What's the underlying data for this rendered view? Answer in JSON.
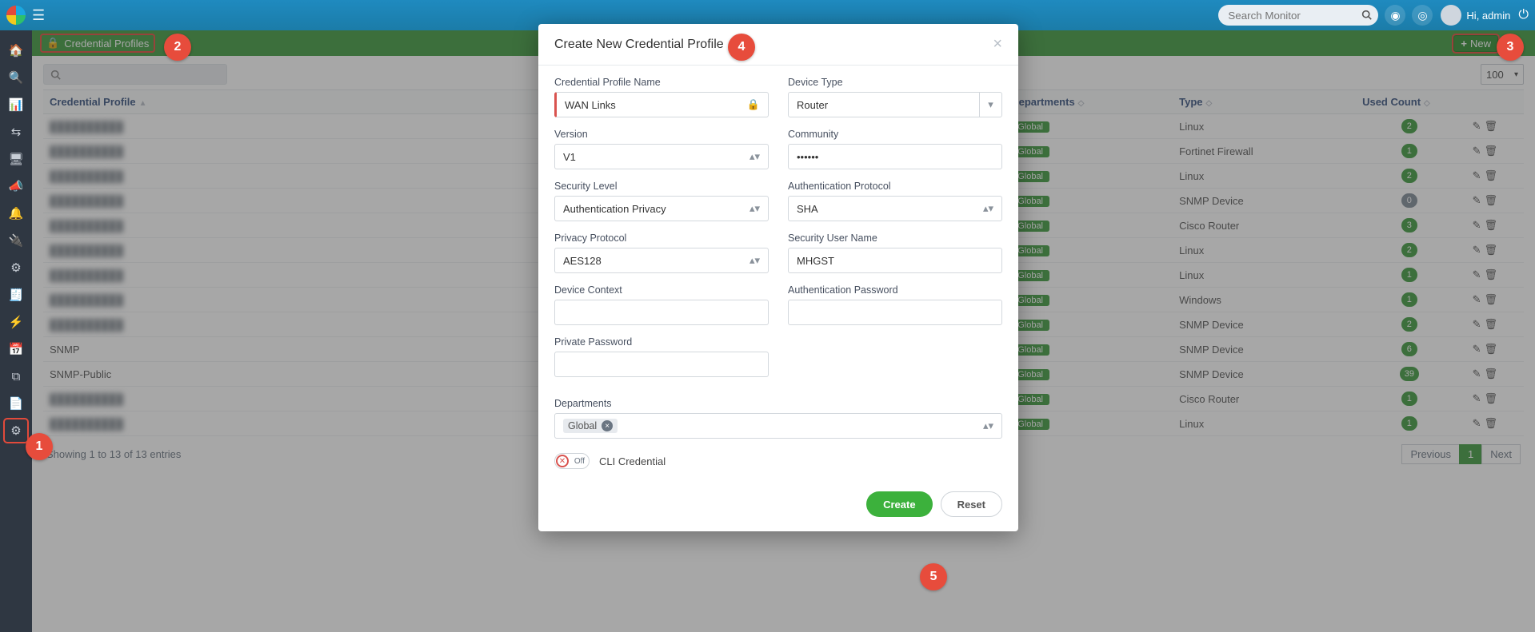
{
  "topbar": {
    "search_placeholder": "Search Monitor",
    "greeting": "Hi, admin"
  },
  "greenbar": {
    "title": "Credential Profiles",
    "new_label": "New"
  },
  "table": {
    "page_size": "100",
    "headers": {
      "name": "Credential Profile",
      "departments": "Departments",
      "type": "Type",
      "used": "Used Count"
    },
    "rows": [
      {
        "name": "—",
        "blur": true,
        "dept": "Global",
        "type": "Linux",
        "count": 2
      },
      {
        "name": "—",
        "blur": true,
        "dept": "Global",
        "type": "Fortinet Firewall",
        "count": 1
      },
      {
        "name": "—",
        "blur": true,
        "dept": "Global",
        "type": "Linux",
        "count": 2
      },
      {
        "name": "—",
        "blur": true,
        "dept": "Global",
        "type": "SNMP Device",
        "count": 0
      },
      {
        "name": "—",
        "blur": true,
        "dept": "Global",
        "type": "Cisco Router",
        "count": 3
      },
      {
        "name": "—",
        "blur": true,
        "dept": "Global",
        "type": "Linux",
        "count": 2
      },
      {
        "name": "—",
        "blur": true,
        "dept": "Global",
        "type": "Linux",
        "count": 1
      },
      {
        "name": "—",
        "blur": true,
        "dept": "Global",
        "type": "Windows",
        "count": 1
      },
      {
        "name": "—",
        "blur": true,
        "dept": "Global",
        "type": "SNMP Device",
        "count": 2
      },
      {
        "name": "SNMP",
        "blur": false,
        "dept": "Global",
        "type": "SNMP Device",
        "count": 6
      },
      {
        "name": "SNMP-Public",
        "blur": false,
        "dept": "Global",
        "type": "SNMP Device",
        "count": 39
      },
      {
        "name": "—",
        "blur": true,
        "dept": "Global",
        "type": "Cisco Router",
        "count": 1
      },
      {
        "name": "—",
        "blur": true,
        "dept": "Global",
        "type": "Linux",
        "count": 1
      }
    ],
    "footer_info": "Showing 1 to 13 of 13 entries",
    "pager": {
      "prev": "Previous",
      "page": "1",
      "next": "Next"
    }
  },
  "modal": {
    "title": "Create New Credential Profile",
    "labels": {
      "name": "Credential Profile Name",
      "device_type": "Device Type",
      "version": "Version",
      "community": "Community",
      "security_level": "Security Level",
      "auth_protocol": "Authentication Protocol",
      "privacy_protocol": "Privacy Protocol",
      "security_user": "Security User Name",
      "device_context": "Device Context",
      "auth_password": "Authentication Password",
      "private_password": "Private Password",
      "departments": "Departments",
      "cli_credential": "CLI Credential"
    },
    "values": {
      "name": "WAN Links",
      "device_type": "Router",
      "version": "V1",
      "community": "••••••",
      "security_level": "Authentication Privacy",
      "auth_protocol": "SHA",
      "privacy_protocol": "AES128",
      "security_user": "MHGST",
      "device_context": "",
      "auth_password": "",
      "private_password": "",
      "department_tag": "Global",
      "toggle_state": "Off"
    },
    "buttons": {
      "create": "Create",
      "reset": "Reset"
    }
  },
  "callouts": {
    "c1": "1",
    "c2": "2",
    "c3": "3",
    "c4": "4",
    "c5": "5"
  }
}
